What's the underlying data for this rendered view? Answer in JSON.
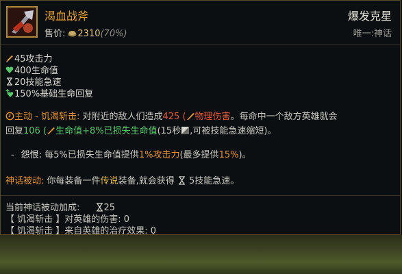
{
  "item": {
    "name": "渴血战斧",
    "price_label": "售价:",
    "price_value": "2310",
    "price_percent": "(70%)",
    "rank": "爆发克星",
    "unique_label": "唯一:",
    "unique_value": "神话"
  },
  "stats": [
    {
      "icon": "attack-damage-icon",
      "text": "45攻击力"
    },
    {
      "icon": "health-icon",
      "text": "400生命值"
    },
    {
      "icon": "ability-haste-icon",
      "text": "20技能急速"
    },
    {
      "icon": "health-regen-icon",
      "text": "150%基础生命回复"
    }
  ],
  "active": {
    "label": "主动 - 饥渴斩击:",
    "t1": "对附近的敌人们造成",
    "damage": "425",
    "paren_open": "(",
    "damage_type": "物理伤害",
    "t2": "。每命中一个敌方英雄就会",
    "t3": "回复",
    "heal": "106",
    "paren_open2": "(",
    "heal_formula": "生命值+8%已损失生命值",
    "cooldown": "(15秒",
    "t4": ",可被技能急速缩短)。"
  },
  "rage": {
    "dash": "-",
    "label": "怨恨:",
    "t1": "每5%已损失生命值提供",
    "bonus": "1%攻击力",
    "t2": "(最多提供",
    "max": "15%",
    "t3": ")。"
  },
  "mythic": {
    "label": "神话被动:",
    "t1": "你每装备一件",
    "legendary": "传说",
    "t2": "装备,就会获得",
    "t3": "5技能急速。"
  },
  "footer": {
    "bonus_label": "当前神话被动加成:",
    "bonus_value": "25",
    "line2": "【 饥渴斩击 】对英雄的伤害: 0",
    "line3": "【 饥渴斩击 】来自英雄的治疗效果: 0"
  },
  "colors": {
    "title": "#e7a22c",
    "physical": "#e05a3c",
    "heal": "#57c86a",
    "gold": "#e4b84c"
  }
}
